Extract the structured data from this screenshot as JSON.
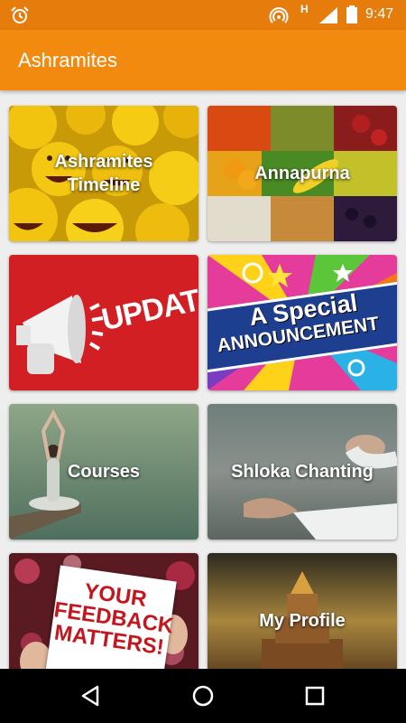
{
  "status_bar": {
    "network_label": "H",
    "time": "9:47",
    "icons": [
      "alarm-icon",
      "hotspot-icon",
      "signal-icon",
      "battery-icon"
    ]
  },
  "app_bar": {
    "title": "Ashramites",
    "color": "#f28a10"
  },
  "tiles": [
    {
      "label": "Ashramites Timeline",
      "image": "emoji-faces"
    },
    {
      "label": "Annapurna",
      "image": "fruits-vegetables"
    },
    {
      "label": "",
      "image": "megaphone-update",
      "image_text": "UPDATE"
    },
    {
      "label": "",
      "image": "special-announcement",
      "image_text_1": "A Special",
      "image_text_2": "ANNOUNCEMENT"
    },
    {
      "label": "Courses",
      "image": "yoga-pose"
    },
    {
      "label": "Shloka Chanting",
      "image": "meditation-hand"
    },
    {
      "label": "",
      "image": "feedback-sign",
      "image_text": "YOUR FEEDBACK MATTERS!"
    },
    {
      "label": "My Profile",
      "image": "temple"
    }
  ],
  "nav_bar": {
    "icons": [
      "back-icon",
      "home-icon",
      "recent-apps-icon"
    ]
  }
}
